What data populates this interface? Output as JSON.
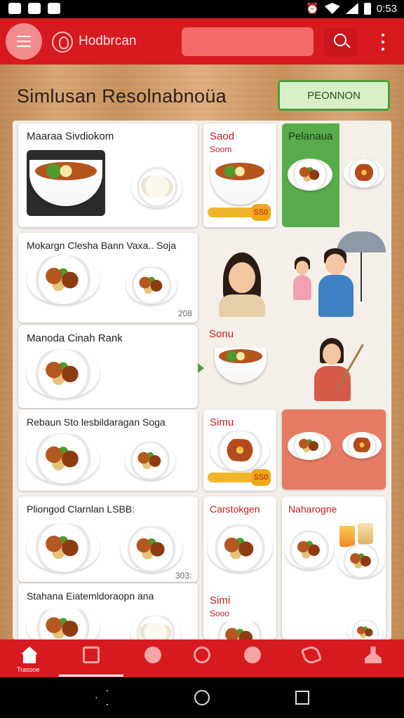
{
  "status_bar": {
    "time": "0:53"
  },
  "app_bar": {
    "app_name": "Hodbrcan",
    "search": {
      "placeholder": ""
    }
  },
  "page": {
    "title": "Simlusan Resolnabnoüa",
    "promo_button": "PEONNON"
  },
  "cards": {
    "c1": {
      "title": "Maaraa Sivdiokom"
    },
    "c2": {
      "title": "Mokargn Clesha Bann Vaxa.. Soja",
      "price": "208"
    },
    "c3": {
      "title": "Manoda Cinah Rank"
    },
    "c4": {
      "title": "Rebaun Sto lesbildaragan   Soga"
    },
    "c5": {
      "title": "Pliongod Clarnlan LSBB:",
      "price": "303:"
    },
    "c6": {
      "title": "Stahana Eiatemldoraopn   ana"
    },
    "s1": {
      "title": "Saod",
      "subtitle": "Soom",
      "price": "SS0"
    },
    "s2": {
      "title": "Pelanaua"
    },
    "s3": {
      "title": "Sonu"
    },
    "s4": {
      "title": "Simu",
      "price": "SS0"
    },
    "s5": {
      "title": "Carstokgen"
    },
    "s6": {
      "title": "Naharogne"
    },
    "s7": {
      "title": "Simi",
      "subtitle": "Sooo"
    }
  },
  "bottom_nav": {
    "items": [
      {
        "icon": "home-icon",
        "label": "Trasooe"
      },
      {
        "icon": "store-icon",
        "label": ""
      },
      {
        "icon": "people-icon",
        "label": ""
      },
      {
        "icon": "location-icon",
        "label": ""
      },
      {
        "icon": "fruit-icon",
        "label": ""
      },
      {
        "icon": "phone-icon",
        "label": ""
      },
      {
        "icon": "user-icon",
        "label": ""
      }
    ]
  },
  "colors": {
    "brand_red": "#d71920",
    "promo_green": "#4e9a3c",
    "accent_yellow": "#f1b52b"
  }
}
